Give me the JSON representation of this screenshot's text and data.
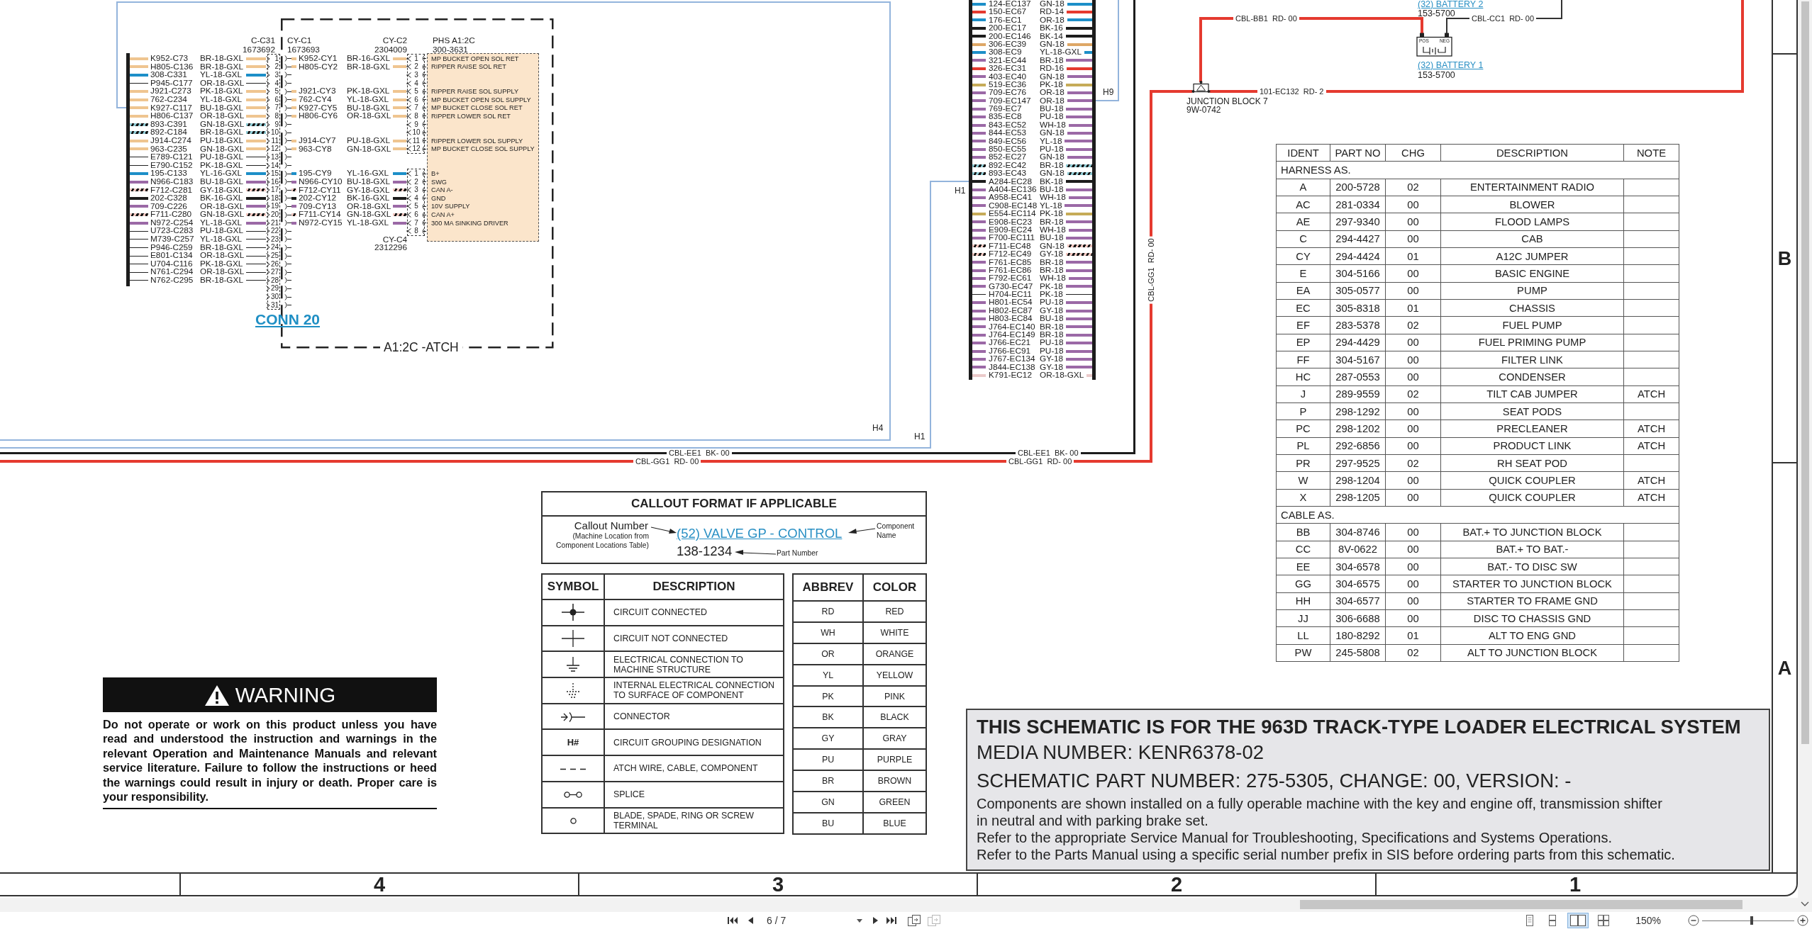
{
  "sheet": {
    "conn_20": {
      "title": "CONN 20",
      "outline_label": "A1:2C -ATCH",
      "plug": {
        "name": "C-C31",
        "part_no": "1673692"
      },
      "receptacle": {
        "name": "CY-C1",
        "part_no": "1673693"
      },
      "component": {
        "name": "PHS A1:2C",
        "part_no": "300-3631"
      },
      "sections": [
        {
          "connector": {
            "name": "CY-C2",
            "part_no": "2304009"
          },
          "rows": [
            {
              "pin": "1",
              "wire": {
                "circuit": "K952-C73",
                "gauge": "BR-18-GXL",
                "kind": "band",
                "color": "#efc590"
              },
              "jumper": {
                "circuit": "K952-CY1",
                "gauge": "BR-16-GXL",
                "kind": "band",
                "color": "#efc590"
              },
              "far_pin": "1",
              "function": "MP BUCKET OPEN SOL RET"
            },
            {
              "pin": "2",
              "wire": {
                "circuit": "H805-C136",
                "gauge": "BR-18-GXL",
                "kind": "band",
                "color": "#efc590"
              },
              "jumper": {
                "circuit": "H805-CY2",
                "gauge": "BR-18-GXL",
                "kind": "band",
                "color": "#efc590"
              },
              "far_pin": "2",
              "function": "RIPPER RAISE SOL RET"
            },
            {
              "pin": "3",
              "wire": {
                "circuit": "308-C331",
                "gauge": "YL-18-GXL",
                "kind": "band",
                "color": "#1d8fc8"
              },
              "far_pin": "3"
            },
            {
              "pin": "4",
              "wire": {
                "circuit": "P945-C177",
                "gauge": "OR-18-GXL",
                "kind": "line"
              },
              "far_pin": "4"
            },
            {
              "pin": "5",
              "wire": {
                "circuit": "J921-C273",
                "gauge": "PK-18-GXL",
                "kind": "band",
                "color": "#efc590"
              },
              "jumper": {
                "circuit": "J921-CY3",
                "gauge": "PK-18-GXL",
                "kind": "band",
                "color": "#efc590"
              },
              "far_pin": "5",
              "function": "RIPPER RAISE SOL SUPPLY"
            },
            {
              "pin": "6",
              "wire": {
                "circuit": "762-C234",
                "gauge": "YL-18-GXL",
                "kind": "band",
                "color": "#efc590"
              },
              "jumper": {
                "circuit": "762-CY4",
                "gauge": "YL-18-GXL",
                "kind": "band",
                "color": "#efc590"
              },
              "far_pin": "6",
              "function": "MP BUCKET OPEN SOL SUPPLY"
            },
            {
              "pin": "7",
              "wire": {
                "circuit": "K927-C117",
                "gauge": "BU-18-GXL",
                "kind": "band",
                "color": "#efc590"
              },
              "jumper": {
                "circuit": "K927-CY5",
                "gauge": "BU-18-GXL",
                "kind": "band",
                "color": "#efc590"
              },
              "far_pin": "7",
              "function": "MP BUCKET CLOSE SOL RET"
            },
            {
              "pin": "8",
              "wire": {
                "circuit": "H806-C137",
                "gauge": "OR-18-GXL",
                "kind": "band",
                "color": "#efc590"
              },
              "jumper": {
                "circuit": "H806-CY6",
                "gauge": "OR-18-GXL",
                "kind": "band",
                "color": "#efc590"
              },
              "far_pin": "8",
              "function": "RIPPER LOWER SOL RET"
            },
            {
              "pin": "9",
              "wire": {
                "circuit": "893-C391",
                "gauge": "GN-18-GXL",
                "kind": "stripe",
                "color": "#8ecad3"
              },
              "far_pin": "9"
            },
            {
              "pin": "10",
              "wire": {
                "circuit": "892-C184",
                "gauge": "BR-18-GXL",
                "kind": "stripe",
                "color": "#8ecad3"
              },
              "far_pin": "10"
            },
            {
              "pin": "11",
              "wire": {
                "circuit": "J914-C274",
                "gauge": "PU-18-GXL",
                "kind": "band",
                "color": "#efc590"
              },
              "jumper": {
                "circuit": "J914-CY7",
                "gauge": "PU-18-GXL",
                "kind": "band",
                "color": "#efc590"
              },
              "far_pin": "11",
              "function": "RIPPER LOWER SOL SUPPLY"
            },
            {
              "pin": "12",
              "wire": {
                "circuit": "963-C235",
                "gauge": "GN-18-GXL",
                "kind": "band",
                "color": "#efc590"
              },
              "jumper": {
                "circuit": "963-CY8",
                "gauge": "GN-18-GXL",
                "kind": "band",
                "color": "#efc590"
              },
              "far_pin": "12",
              "function": "MP BUCKET CLOSE SOL SUPPLY"
            }
          ]
        },
        {
          "rows": [
            {
              "pin": "13",
              "wire": {
                "circuit": "E789-C121",
                "gauge": "PU-18-GXL",
                "kind": "line"
              }
            },
            {
              "pin": "14",
              "wire": {
                "circuit": "E790-C152",
                "gauge": "PK-18-GXL",
                "kind": "line"
              }
            }
          ]
        },
        {
          "connector": {
            "name": "CY-C4",
            "part_no": "2312296"
          },
          "rows": [
            {
              "pin": "15",
              "wire": {
                "circuit": "195-C133",
                "gauge": "YL-16-GXL",
                "kind": "band",
                "color": "#1d8fc8"
              },
              "jumper": {
                "circuit": "195-CY9",
                "gauge": "YL-16-GXL",
                "kind": "band",
                "color": "#1d8fc8"
              },
              "far_pin": "1",
              "function": "B+"
            },
            {
              "pin": "16",
              "wire": {
                "circuit": "N966-C183",
                "gauge": "BU-18-GXL",
                "kind": "band",
                "color": "#9b69a6"
              },
              "jumper": {
                "circuit": "N966-CY10",
                "gauge": "BU-18-GXL",
                "kind": "band",
                "color": "#9b69a6"
              },
              "far_pin": "2",
              "function": "SWG"
            },
            {
              "pin": "17",
              "wire": {
                "circuit": "F712-C281",
                "gauge": "GY-18-GXL",
                "kind": "stripe",
                "color": "#f2c7c0"
              },
              "jumper": {
                "circuit": "F712-CY11",
                "gauge": "GY-18-GXL",
                "kind": "stripe",
                "color": "#f2c7c0"
              },
              "far_pin": "3",
              "function": "CAN A-"
            },
            {
              "pin": "18",
              "wire": {
                "circuit": "202-C328",
                "gauge": "BK-16-GXL",
                "kind": "band",
                "color": "#1c1c1c"
              },
              "jumper": {
                "circuit": "202-CY12",
                "gauge": "BK-16-GXL",
                "kind": "band",
                "color": "#1c1c1c"
              },
              "far_pin": "4",
              "function": "GND"
            },
            {
              "pin": "19",
              "wire": {
                "circuit": "709-C226",
                "gauge": "OR-18-GXL",
                "kind": "band",
                "color": "#9b69a6"
              },
              "jumper": {
                "circuit": "709-CY13",
                "gauge": "OR-18-GXL",
                "kind": "band",
                "color": "#9b69a6"
              },
              "far_pin": "5",
              "function": "10V SUPPLY"
            },
            {
              "pin": "20",
              "wire": {
                "circuit": "F711-C280",
                "gauge": "GN-18-GXL",
                "kind": "stripe",
                "color": "#f2c7c0"
              },
              "jumper": {
                "circuit": "F711-CY14",
                "gauge": "GN-18-GXL",
                "kind": "stripe",
                "color": "#f2c7c0"
              },
              "far_pin": "6",
              "function": "CAN A+"
            },
            {
              "pin": "21",
              "wire": {
                "circuit": "N972-C254",
                "gauge": "YL-18-GXL",
                "kind": "band",
                "color": "#9b69a6"
              },
              "jumper": {
                "circuit": "N972-CY15",
                "gauge": "YL-18-GXL",
                "kind": "band",
                "color": "#9b69a6"
              },
              "far_pin": "7",
              "function": "300 MA SINKING DRIVER"
            },
            {
              "pin": "22",
              "wire": {
                "circuit": "U723-C283",
                "gauge": "PU-18-GXL",
                "kind": "line"
              },
              "far_pin": "8"
            }
          ]
        },
        {
          "rows": [
            {
              "pin": "23",
              "wire": {
                "circuit": "M739-C257",
                "gauge": "YL-18-GXL",
                "kind": "line"
              }
            },
            {
              "pin": "24",
              "wire": {
                "circuit": "P946-C259",
                "gauge": "BR-18-GXL",
                "kind": "line"
              }
            },
            {
              "pin": "25",
              "wire": {
                "circuit": "E801-C134",
                "gauge": "OR-18-GXL",
                "kind": "line"
              }
            },
            {
              "pin": "26",
              "wire": {
                "circuit": "U704-C116",
                "gauge": "PK-18-GXL",
                "kind": "line"
              }
            },
            {
              "pin": "27",
              "wire": {
                "circuit": "N761-C294",
                "gauge": "OR-18-GXL",
                "kind": "line"
              }
            },
            {
              "pin": "28",
              "wire": {
                "circuit": "N762-C295",
                "gauge": "BR-18-GXL",
                "kind": "line"
              }
            },
            {
              "pin": "29"
            },
            {
              "pin": "30"
            },
            {
              "pin": "31"
            }
          ]
        }
      ]
    },
    "ec_harness": {
      "wires": [
        {
          "circuit": "124-EC137",
          "gauge": "GN-18",
          "kind": "band",
          "color": "#1d8fc8"
        },
        {
          "circuit": "150-EC67",
          "gauge": "RD-14",
          "kind": "band",
          "color": "#e53a2f"
        },
        {
          "circuit": "176-EC1",
          "gauge": "OR-18",
          "kind": "band",
          "color": "#1d8fc8"
        },
        {
          "circuit": "200-EC17",
          "gauge": "BK-16",
          "kind": "band",
          "color": "#1c1c1c"
        },
        {
          "circuit": "200-EC146",
          "gauge": "BK-14",
          "kind": "band",
          "color": "#1c1c1c"
        },
        {
          "circuit": "306-EC39",
          "gauge": "GN-18",
          "kind": "band",
          "color": "#dea766"
        },
        {
          "circuit": "308-EC9",
          "gauge": "YL-18-GXL",
          "kind": "band",
          "color": "#1d8fc8"
        },
        {
          "circuit": "321-EC44",
          "gauge": "BR-18",
          "kind": "band",
          "color": "#9b69a6"
        },
        {
          "circuit": "326-EC31",
          "gauge": "RD-16",
          "kind": "band",
          "color": "#e53a2f"
        },
        {
          "circuit": "403-EC40",
          "gauge": "GN-18",
          "kind": "band",
          "color": "#9b69a6"
        },
        {
          "circuit": "519-EC36",
          "gauge": "PK-18",
          "kind": "band",
          "color": "#c6ab58"
        },
        {
          "circuit": "709-EC76",
          "gauge": "OR-18",
          "kind": "band",
          "color": "#9b69a6"
        },
        {
          "circuit": "709-EC147",
          "gauge": "OR-18",
          "kind": "band",
          "color": "#9b69a6"
        },
        {
          "circuit": "769-EC7",
          "gauge": "BU-18",
          "kind": "band",
          "color": "#9b69a6"
        },
        {
          "circuit": "835-EC8",
          "gauge": "PU-18",
          "kind": "band",
          "color": "#9b69a6"
        },
        {
          "circuit": "843-EC52",
          "gauge": "WH-18",
          "kind": "band",
          "color": "#9b69a6"
        },
        {
          "circuit": "844-EC53",
          "gauge": "GN-18",
          "kind": "band",
          "color": "#9b69a6"
        },
        {
          "circuit": "849-EC56",
          "gauge": "YL-18",
          "kind": "band",
          "color": "#9b69a6"
        },
        {
          "circuit": "850-EC55",
          "gauge": "PU-18",
          "kind": "band",
          "color": "#9b69a6"
        },
        {
          "circuit": "852-EC27",
          "gauge": "GN-18",
          "kind": "band",
          "color": "#9b69a6"
        },
        {
          "circuit": "892-EC42",
          "gauge": "BR-18",
          "kind": "stripe",
          "color": "#8ecad3"
        },
        {
          "circuit": "893-EC43",
          "gauge": "GN-18",
          "kind": "stripe",
          "color": "#8ecad3"
        },
        {
          "circuit": "A284-EC28",
          "gauge": "BK-18",
          "kind": "band",
          "color": "#1c1c1c"
        },
        {
          "circuit": "A404-EC136",
          "gauge": "BU-18",
          "kind": "band",
          "color": "#9b69a6"
        },
        {
          "circuit": "A958-EC41",
          "gauge": "WH-18",
          "kind": "band",
          "color": "#9b69a6"
        },
        {
          "circuit": "C908-EC148",
          "gauge": "YL-18",
          "kind": "band",
          "color": "#9b69a6"
        },
        {
          "circuit": "E554-EC114",
          "gauge": "PK-18",
          "kind": "band",
          "color": "#c6ab58"
        },
        {
          "circuit": "E908-EC23",
          "gauge": "BR-18",
          "kind": "band",
          "color": "#9b69a6"
        },
        {
          "circuit": "E909-EC24",
          "gauge": "WH-18",
          "kind": "band",
          "color": "#9b69a6"
        },
        {
          "circuit": "F700-EC111",
          "gauge": "BU-18",
          "kind": "band",
          "color": "#9b69a6"
        },
        {
          "circuit": "F711-EC48",
          "gauge": "GN-18",
          "kind": "stripe",
          "color": "#f2c7c0"
        },
        {
          "circuit": "F712-EC49",
          "gauge": "GY-18",
          "kind": "stripe",
          "color": "#f2c7c0"
        },
        {
          "circuit": "F761-EC85",
          "gauge": "BR-18",
          "kind": "band",
          "color": "#9b69a6"
        },
        {
          "circuit": "F761-EC86",
          "gauge": "BR-18",
          "kind": "band",
          "color": "#9b69a6"
        },
        {
          "circuit": "F792-EC61",
          "gauge": "WH-18",
          "kind": "band",
          "color": "#9b69a6"
        },
        {
          "circuit": "G730-EC47",
          "gauge": "PK-18",
          "kind": "band",
          "color": "#9b69a6"
        },
        {
          "circuit": "H704-EC11",
          "gauge": "PK-18",
          "kind": "line"
        },
        {
          "circuit": "H801-EC54",
          "gauge": "PU-18",
          "kind": "band",
          "color": "#9b69a6"
        },
        {
          "circuit": "H802-EC87",
          "gauge": "GY-18",
          "kind": "band",
          "color": "#9b69a6"
        },
        {
          "circuit": "H803-EC84",
          "gauge": "BU-18",
          "kind": "band",
          "color": "#9b69a6"
        },
        {
          "circuit": "J764-EC140",
          "gauge": "BR-18",
          "kind": "band",
          "color": "#9b69a6"
        },
        {
          "circuit": "J764-EC149",
          "gauge": "BR-18",
          "kind": "band",
          "color": "#9b69a6"
        },
        {
          "circuit": "J766-EC21",
          "gauge": "PU-18",
          "kind": "band",
          "color": "#9b69a6"
        },
        {
          "circuit": "J766-EC91",
          "gauge": "PU-18",
          "kind": "band",
          "color": "#9b69a6"
        },
        {
          "circuit": "J767-EC134",
          "gauge": "GY-18",
          "kind": "band",
          "color": "#9b69a6"
        },
        {
          "circuit": "J844-EC138",
          "gauge": "GY-18",
          "kind": "band",
          "color": "#9b69a6"
        },
        {
          "circuit": "K791-EC12",
          "gauge": "OR-18-GXL",
          "kind": "band",
          "color": "#ebcaca"
        }
      ]
    },
    "harness_links": [
      {
        "labels": [
          "H4"
        ]
      },
      {
        "labels": [
          "H1",
          "H1"
        ]
      },
      {
        "labels": [
          "H9"
        ]
      }
    ],
    "cables": [
      {
        "labels": [
          "CBL-EE1  BK- 00",
          "CBL-EE1  BK- 00"
        ],
        "color": "#1c1c1c"
      },
      {
        "labels": [
          "CBL-GG1  RD- 00",
          "CBL-GG1  RD- 00",
          "CBL-GG1  RD- 00"
        ],
        "color": "#e53a2f"
      },
      {
        "labels": [
          "CBL-BB1  RD- 00"
        ],
        "color": "#e53a2f"
      },
      {
        "labels": [
          "CBL-CC1  RD- 00"
        ],
        "color": "#333333"
      },
      {
        "labels": [
          "101-EC132  RD- 2"
        ],
        "color": "#e53a2f"
      }
    ],
    "junction_block": {
      "name": "JUNCTION BLOCK 7",
      "part_no": "9W-0742"
    },
    "batteries": [
      {
        "callout": "(32) BATTERY 2",
        "part_no": "153-5700"
      },
      {
        "callout": "(32) BATTERY 1",
        "part_no": "153-5700",
        "terminals": [
          "POS",
          "NEG"
        ]
      }
    ],
    "parts_table": {
      "columns": [
        "IDENT",
        "PART NO",
        "CHG",
        "DESCRIPTION",
        "NOTE"
      ],
      "groups": [
        {
          "title": "HARNESS AS.",
          "rows": [
            {
              "ident": "A",
              "part_no": "200-5728",
              "chg": "02",
              "description": "ENTERTAINMENT RADIO"
            },
            {
              "ident": "AC",
              "part_no": "281-0334",
              "chg": "00",
              "description": "BLOWER"
            },
            {
              "ident": "AE",
              "part_no": "297-9340",
              "chg": "00",
              "description": "FLOOD LAMPS"
            },
            {
              "ident": "C",
              "part_no": "294-4427",
              "chg": "00",
              "description": "CAB"
            },
            {
              "ident": "CY",
              "part_no": "294-4424",
              "chg": "01",
              "description": "A12C JUMPER"
            },
            {
              "ident": "E",
              "part_no": "304-5166",
              "chg": "00",
              "description": "BASIC ENGINE"
            },
            {
              "ident": "EA",
              "part_no": "305-0577",
              "chg": "00",
              "description": "PUMP"
            },
            {
              "ident": "EC",
              "part_no": "305-8318",
              "chg": "01",
              "description": "CHASSIS"
            },
            {
              "ident": "EF",
              "part_no": "283-5378",
              "chg": "02",
              "description": "FUEL PUMP"
            },
            {
              "ident": "EP",
              "part_no": "294-4429",
              "chg": "00",
              "description": "FUEL PRIMING PUMP"
            },
            {
              "ident": "FF",
              "part_no": "304-5167",
              "chg": "00",
              "description": "FILTER LINK"
            },
            {
              "ident": "HC",
              "part_no": "287-0553",
              "chg": "00",
              "description": "CONDENSER"
            },
            {
              "ident": "J",
              "part_no": "289-9559",
              "chg": "02",
              "description": "TILT CAB JUMPER",
              "note": "ATCH"
            },
            {
              "ident": "P",
              "part_no": "298-1292",
              "chg": "00",
              "description": "SEAT PODS"
            },
            {
              "ident": "PC",
              "part_no": "298-1202",
              "chg": "00",
              "description": "PRECLEANER",
              "note": "ATCH"
            },
            {
              "ident": "PL",
              "part_no": "292-6856",
              "chg": "00",
              "description": "PRODUCT LINK",
              "note": "ATCH"
            },
            {
              "ident": "PR",
              "part_no": "297-9525",
              "chg": "02",
              "description": "RH SEAT POD"
            },
            {
              "ident": "W",
              "part_no": "298-1204",
              "chg": "00",
              "description": "QUICK COUPLER",
              "note": "ATCH"
            },
            {
              "ident": "X",
              "part_no": "298-1205",
              "chg": "00",
              "description": "QUICK COUPLER",
              "note": "ATCH"
            }
          ]
        },
        {
          "title": "CABLE AS.",
          "rows": [
            {
              "ident": "BB",
              "part_no": "304-8746",
              "chg": "00",
              "description": "BAT.+ TO JUNCTION BLOCK"
            },
            {
              "ident": "CC",
              "part_no": "8V-0622",
              "chg": "00",
              "description": "BAT.+ TO BAT.-"
            },
            {
              "ident": "EE",
              "part_no": "304-6578",
              "chg": "00",
              "description": "BAT.- TO DISC SW"
            },
            {
              "ident": "GG",
              "part_no": "304-6575",
              "chg": "00",
              "description": "STARTER TO JUNCTION BLOCK"
            },
            {
              "ident": "HH",
              "part_no": "304-6577",
              "chg": "00",
              "description": "STARTER TO FRAME GND"
            },
            {
              "ident": "JJ",
              "part_no": "306-6688",
              "chg": "00",
              "description": "DISC TO CHASSIS GND"
            },
            {
              "ident": "LL",
              "part_no": "180-8292",
              "chg": "01",
              "description": "ALT TO ENG GND"
            },
            {
              "ident": "PW",
              "part_no": "245-5808",
              "chg": "02",
              "description": "ALT TO JUNCTION BLOCK"
            }
          ]
        }
      ]
    },
    "callout_format": {
      "title": "CALLOUT FORMAT IF APPLICABLE",
      "callout_label": "Callout Number",
      "callout_note": "(Machine Location from Component Locations Table)",
      "example_name": "(52) VALVE GP - CONTROL",
      "component_label": "Component Name",
      "example_part_no": "138-1234",
      "part_label": "Part Number"
    },
    "symbol_legend": {
      "columns": [
        "SYMBOL",
        "DESCRIPTION"
      ],
      "rows": [
        {
          "kind": "connected",
          "description": "CIRCUIT CONNECTED"
        },
        {
          "kind": "not_connected",
          "description": "CIRCUIT NOT CONNECTED"
        },
        {
          "kind": "ground",
          "description": "ELECTRICAL CONNECTION TO MACHINE STRUCTURE"
        },
        {
          "kind": "internal_ground",
          "description": "INTERNAL ELECTRICAL CONNECTION TO SURFACE OF COMPONENT"
        },
        {
          "kind": "connector",
          "description": "CONNECTOR"
        },
        {
          "kind": "grouping",
          "symbol": "H#",
          "description": "CIRCUIT GROUPING DESIGNATION"
        },
        {
          "kind": "atch",
          "description": "ATCH WIRE, CABLE, COMPONENT"
        },
        {
          "kind": "splice",
          "description": "SPLICE"
        },
        {
          "kind": "terminal",
          "description": "BLADE, SPADE, RING OR SCREW TERMINAL"
        }
      ]
    },
    "color_legend": {
      "columns": [
        "ABBREV",
        "COLOR"
      ],
      "rows": [
        {
          "abbrev": "RD",
          "name": "RED"
        },
        {
          "abbrev": "WH",
          "name": "WHITE"
        },
        {
          "abbrev": "OR",
          "name": "ORANGE"
        },
        {
          "abbrev": "YL",
          "name": "YELLOW"
        },
        {
          "abbrev": "PK",
          "name": "PINK"
        },
        {
          "abbrev": "BK",
          "name": "BLACK"
        },
        {
          "abbrev": "GY",
          "name": "GRAY"
        },
        {
          "abbrev": "PU",
          "name": "PURPLE"
        },
        {
          "abbrev": "BR",
          "name": "BROWN"
        },
        {
          "abbrev": "GN",
          "name": "GREEN"
        },
        {
          "abbrev": "BU",
          "name": "BLUE"
        }
      ]
    },
    "warning": {
      "title": "WARNING",
      "text": "Do not operate or work on this product unless you have read and understood the instruction and warnings in the relevant Operation and Maintenance Manuals and relevant service literature. Failure to follow the instructions or heed the warnings could result in injury or death. Proper care is your responsibility."
    },
    "title_block": {
      "heading": "THIS SCHEMATIC IS FOR THE 963D TRACK-TYPE LOADER ELECTRICAL SYSTEM",
      "media_number": "MEDIA NUMBER: KENR6378-02",
      "part_number": "SCHEMATIC PART NUMBER: 275-5305, CHANGE: 00, VERSION: -",
      "notes": [
        "Components are shown installed on a fully operable machine with the key and engine off, transmission shifter",
        "in neutral and with parking brake set.",
        "Refer to the appropriate Service Manual for Troubleshooting, Specifications and Systems Operations.",
        "Refer to the Parts Manual using a specific serial number prefix in SIS before ordering parts from this schematic."
      ]
    },
    "zones": {
      "columns": [
        "4",
        "3",
        "2",
        "1"
      ],
      "rows": [
        "B",
        "A"
      ]
    }
  },
  "viewer": {
    "page": "6 / 7",
    "page_tools": [
      {
        "disabled": false
      },
      {
        "disabled": true
      }
    ],
    "view_modes": [
      {
        "selected": false
      },
      {
        "selected": false
      },
      {
        "selected": true
      },
      {
        "selected": false
      }
    ],
    "zoom": "150%",
    "zoom_slider": {
      "level": 0.54
    }
  }
}
